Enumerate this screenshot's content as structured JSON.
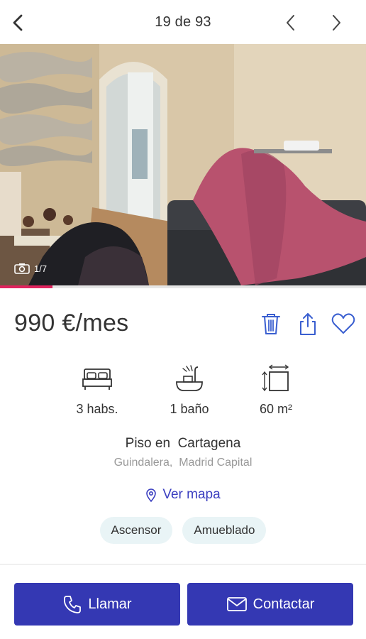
{
  "header": {
    "counter": "19 de 93",
    "back_icon": "chevron-left-icon",
    "prev_icon": "chevron-left-icon",
    "next_icon": "chevron-right-icon"
  },
  "gallery": {
    "photo_counter": "1/7",
    "progress_fraction": 0.1428,
    "accent_color": "#e0245e"
  },
  "listing": {
    "price": "990 €/mes",
    "features": {
      "bedrooms": "3 habs.",
      "bathrooms": "1 baño",
      "area": "60 m²"
    },
    "property_type": "Piso en  Cartagena",
    "location": "Guindalera,  Madrid Capital",
    "map_link": "Ver mapa",
    "tags": [
      "Ascensor",
      "Amueblado"
    ]
  },
  "actions": {
    "call_label": "Llamar",
    "contact_label": "Contactar",
    "button_color": "#3438b3"
  }
}
